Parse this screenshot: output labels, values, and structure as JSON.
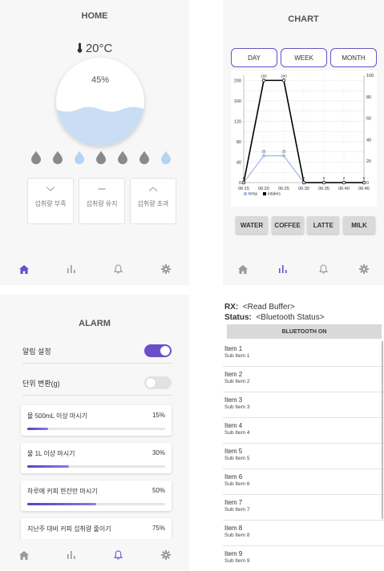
{
  "colors": {
    "accent": "#6a4fc9",
    "water": "#c9ddf5",
    "drop_gray": "#8a8a8a",
    "drop_blue": "#b5d3f3",
    "toggle_off": "#e2e2e2"
  },
  "home": {
    "title": "HOME",
    "temperature": "20°C",
    "water_percent": "45%",
    "water_level": 0.45,
    "drops": [
      "gray",
      "gray",
      "blue",
      "gray",
      "gray",
      "gray",
      "blue"
    ],
    "buttons": [
      {
        "icon": "chevron-down-icon",
        "label": "섭취량 부족"
      },
      {
        "icon": "minus-icon",
        "label": "섭취량 유지"
      },
      {
        "icon": "chevron-up-icon",
        "label": "섭취량 초과"
      }
    ]
  },
  "chart": {
    "title": "CHART",
    "tabs": [
      "DAY",
      "WEEK",
      "MONTH"
    ],
    "drinks": [
      "WATER",
      "COFFEE",
      "LATTE",
      "MILK"
    ],
    "legend": [
      "temp",
      "intakes"
    ]
  },
  "chart_data": {
    "type": "line",
    "x": [
      "06:15",
      "06:20",
      "06:25",
      "06:30",
      "06:35",
      "06:40",
      "06:46"
    ],
    "series": [
      {
        "name": "temp",
        "axis": "right",
        "values": [
          0,
          25,
          25,
          0,
          0,
          0,
          0
        ],
        "color": "#a9bfe6"
      },
      {
        "name": "intakes",
        "axis": "left",
        "values": [
          0,
          200,
          200,
          0,
          0,
          0,
          0
        ],
        "color": "#000000"
      }
    ],
    "point_labels": {
      "temp": [
        "0",
        "25",
        "25",
        "",
        "",
        "",
        ""
      ],
      "intakes": [
        "0",
        "200",
        "200",
        "0",
        "0",
        "0",
        "0"
      ]
    },
    "y_left": {
      "ticks": [
        0,
        20,
        40,
        60,
        80,
        100,
        120,
        140,
        160,
        180,
        200
      ],
      "labels": [
        "0",
        "40",
        "80",
        "120",
        "160",
        "200"
      ],
      "ylim": [
        0,
        210
      ]
    },
    "y_right": {
      "labels": [
        "0",
        "20",
        "40",
        "60",
        "80",
        "100"
      ],
      "ylim": [
        0,
        100
      ]
    },
    "grid": true,
    "legend_position": "bottom-left"
  },
  "alarm": {
    "title": "ALARM",
    "settings": [
      {
        "label": "알림 설정",
        "on": true
      },
      {
        "label": "단위 변환(g)",
        "on": false
      }
    ],
    "goals": [
      {
        "label": "물 500mL 이상 마시기",
        "percent": "15%",
        "value": 0.15
      },
      {
        "label": "물 1L 이상 마시기",
        "percent": "30%",
        "value": 0.3
      },
      {
        "label": "하루에 커피 한잔만 마시기",
        "percent": "50%",
        "value": 0.5
      },
      {
        "label": "지난주 대비 커피 섭취량 줄이기",
        "percent": "75%",
        "value": 0.75
      }
    ]
  },
  "bluetooth": {
    "rx_label": "RX:",
    "rx_value": "<Read Buffer>",
    "status_label": "Status:",
    "status_value": "<Bluetooth Status>",
    "button": "BLUETOOTH ON",
    "items": [
      {
        "title": "Item 1",
        "sub": "Sub Item 1"
      },
      {
        "title": "Item 2",
        "sub": "Sub Item 2"
      },
      {
        "title": "Item 3",
        "sub": "Sub Item 3"
      },
      {
        "title": "Item 4",
        "sub": "Sub Item 4"
      },
      {
        "title": "Item 5",
        "sub": "Sub Item 5"
      },
      {
        "title": "Item 6",
        "sub": "Sub Item 6"
      },
      {
        "title": "Item 7",
        "sub": "Sub Item 7"
      },
      {
        "title": "Item 8",
        "sub": "Sub Item 8"
      },
      {
        "title": "Item 9",
        "sub": "Sub Item 9"
      }
    ]
  },
  "nav": {
    "items": [
      "home-icon",
      "chart-icon",
      "bell-icon",
      "gear-icon"
    ],
    "home_active": 0,
    "chart_active": 1,
    "alarm_active": 2
  }
}
